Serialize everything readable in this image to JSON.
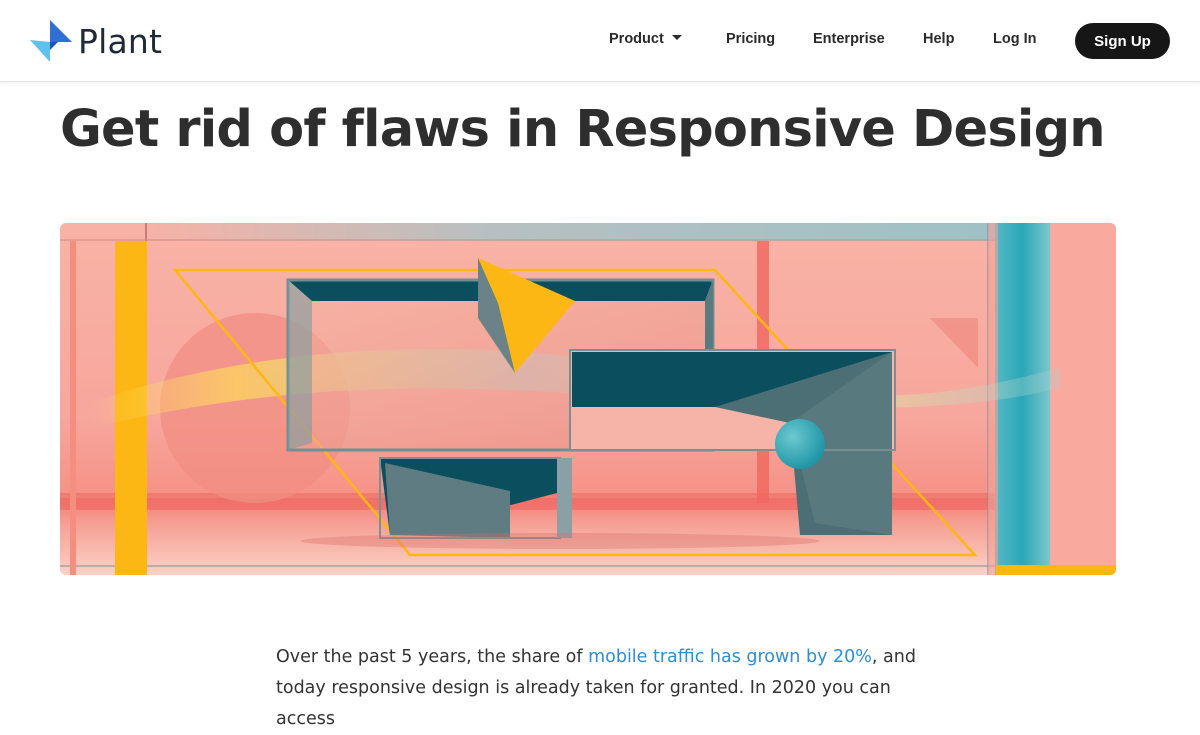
{
  "brand": {
    "name": "Plant",
    "logo_icon": "plant-logo-icon",
    "colors": {
      "logo_dark": "#2f6fd6",
      "logo_light": "#5ec1ee"
    }
  },
  "nav": {
    "product": "Product",
    "pricing": "Pricing",
    "enterprise": "Enterprise",
    "help": "Help",
    "login": "Log In",
    "signup": "Sign Up"
  },
  "article": {
    "title": "Get rid of flaws in Responsive Design",
    "intro_before": "Over the past 5 years, the share of ",
    "intro_link": "mobile traffic has grown by 20%",
    "intro_after": ", and",
    "intro_line2": "today responsive design is already taken for granted. In 2020 you can access",
    "link_color": "#2b8fd6"
  },
  "hero": {
    "image": "abstract-geometric-illustration",
    "colors": {
      "coral": "#f7a49b",
      "teal": "#0b4f5e",
      "yellow": "#fdb714",
      "cyan": "#2aa7b8"
    }
  }
}
